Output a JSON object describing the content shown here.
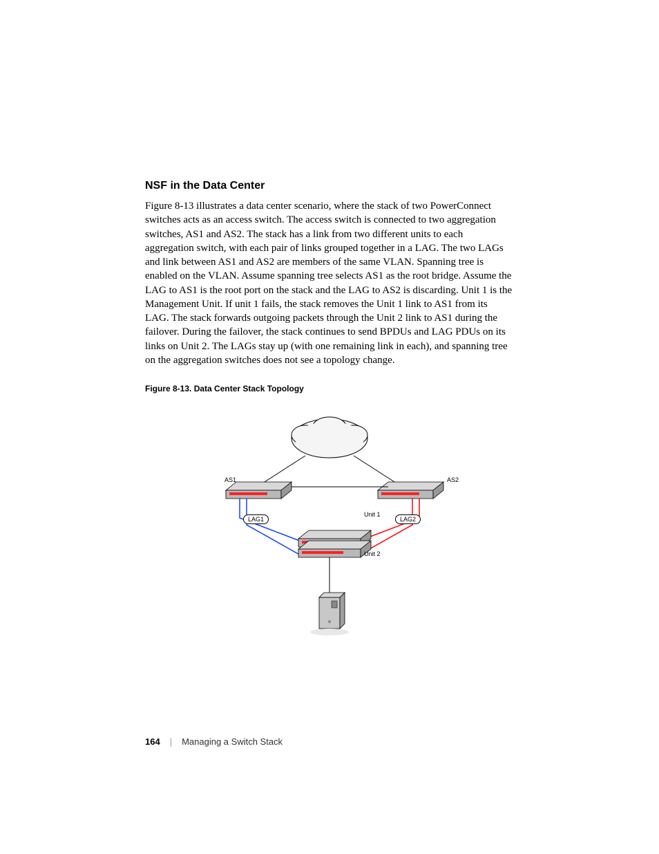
{
  "heading": "NSF in the Data Center",
  "paragraph": "Figure 8-13 illustrates a data center scenario, where the stack of two PowerConnect switches acts as an access switch. The access switch is connected to two aggregation switches, AS1 and AS2. The stack has a link from two different units to each aggregation switch, with each pair of links grouped together in a LAG. The two LAGs and link between AS1 and AS2 are members of the same VLAN. Spanning tree is enabled on the VLAN. Assume spanning tree selects AS1 as the root bridge. Assume the LAG to AS1 is the root port on the stack and the LAG to AS2 is discarding. Unit 1 is the Management Unit. If unit 1 fails, the stack removes the Unit 1 link to AS1 from its LAG. The stack forwards outgoing packets through the Unit 2 link to AS1 during the failover. During the failover, the stack continues to send BPDUs and LAG PDUs on its links on Unit 2. The LAGs stay up (with one remaining link in each), and spanning tree on the aggregation switches does not see a topology change.",
  "figure_caption": "Figure 8-13.    Data Center Stack Topology",
  "diagram": {
    "as1": "AS1",
    "as2": "AS2",
    "lag1": "LAG1",
    "lag2": "LAG2",
    "unit1": "Unit 1",
    "unit2": "Unit 2"
  },
  "footer": {
    "page_number": "164",
    "separator": "|",
    "chapter": "Managing a Switch Stack"
  }
}
